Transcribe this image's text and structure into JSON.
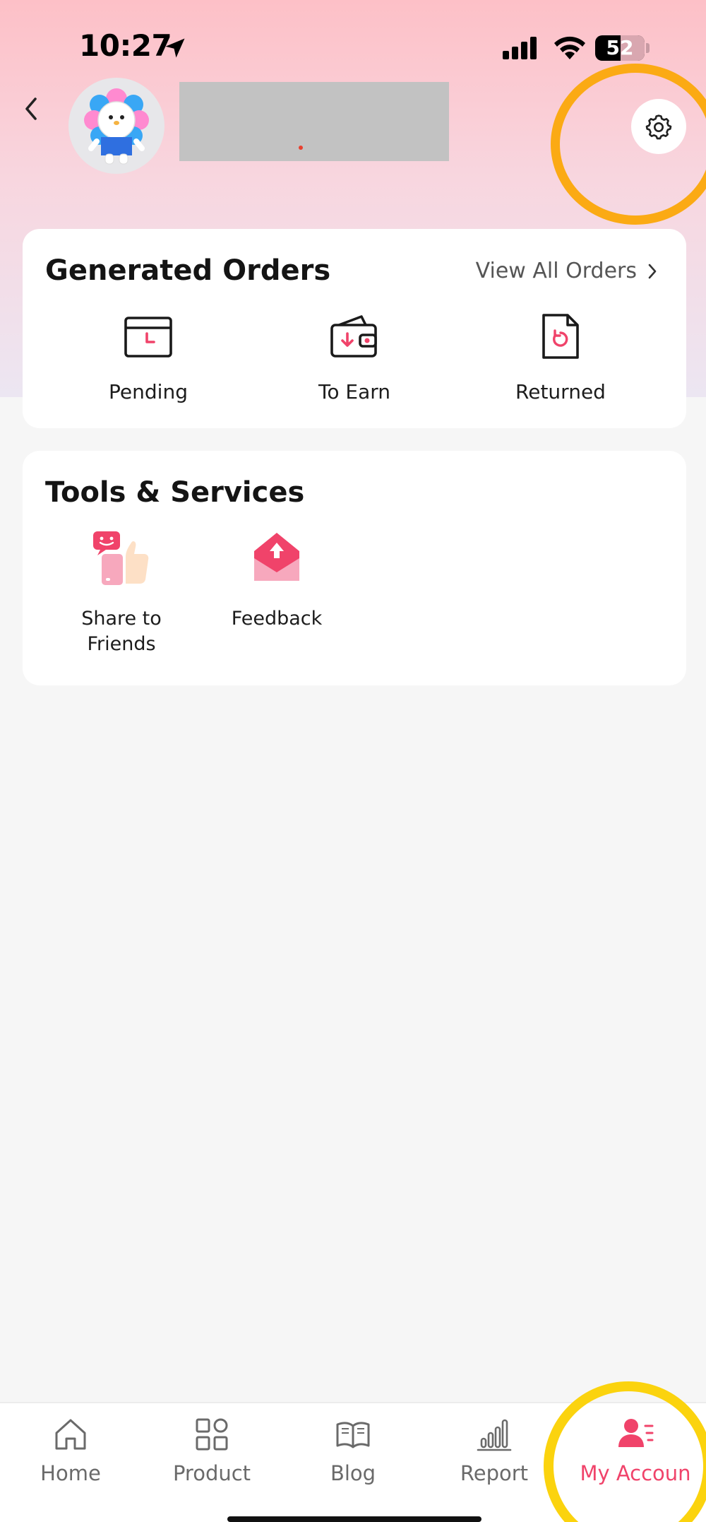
{
  "status_bar": {
    "time": "10:27",
    "battery": "52",
    "battery_level": 0.52
  },
  "header": {
    "back_icon": "chevron-left-icon",
    "settings_icon": "gear-icon"
  },
  "orders": {
    "title": "Generated Orders",
    "view_all": "View All Orders",
    "items": [
      {
        "label": "Pending",
        "icon": "pending-wallet-icon"
      },
      {
        "label": "To Earn",
        "icon": "earn-wallet-icon"
      },
      {
        "label": "Returned",
        "icon": "returned-document-icon"
      }
    ]
  },
  "tools": {
    "title": "Tools & Services",
    "items": [
      {
        "label": "Share to Friends",
        "icon": "share-thumbs-up-icon"
      },
      {
        "label": "Feedback",
        "icon": "feedback-envelope-icon"
      }
    ]
  },
  "nav": {
    "items": [
      {
        "label": "Home",
        "icon": "home-icon"
      },
      {
        "label": "Product",
        "icon": "grid-icon"
      },
      {
        "label": "Blog",
        "icon": "book-icon"
      },
      {
        "label": "Report",
        "icon": "bar-chart-icon"
      },
      {
        "label": "My Accoun",
        "icon": "account-icon",
        "active": true
      }
    ]
  },
  "colors": {
    "accent": "#f0436a",
    "highlight_ring_settings": "#fbaa14",
    "highlight_ring_account": "#fbd30e"
  }
}
